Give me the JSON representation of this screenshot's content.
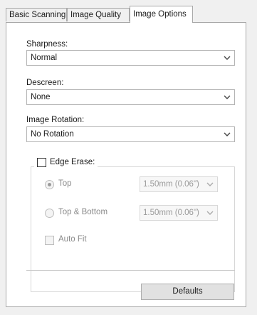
{
  "tabs": [
    {
      "label": "Basic Scanning"
    },
    {
      "label": "Image Quality"
    },
    {
      "label": "Image Options"
    }
  ],
  "sharpness": {
    "label": "Sharpness:",
    "value": "Normal"
  },
  "descreen": {
    "label": "Descreen:",
    "value": "None"
  },
  "rotation": {
    "label": "Image Rotation:",
    "value": "No Rotation"
  },
  "edge_erase": {
    "label": "Edge Erase:",
    "checked": false,
    "top": {
      "label": "Top",
      "selected": true,
      "value": "1.50mm (0.06\")"
    },
    "top_bottom": {
      "label": "Top & Bottom",
      "selected": false,
      "value": "1.50mm (0.06\")"
    },
    "auto_fit": {
      "label": "Auto Fit",
      "checked": false
    }
  },
  "defaults_button": {
    "label": "Defaults"
  },
  "icons": {
    "dropdown": "chevron-down-icon"
  },
  "colors": {
    "panel_bg": "#ffffff",
    "window_bg": "#f0f0f0",
    "disabled_text": "#8a8a8a"
  }
}
